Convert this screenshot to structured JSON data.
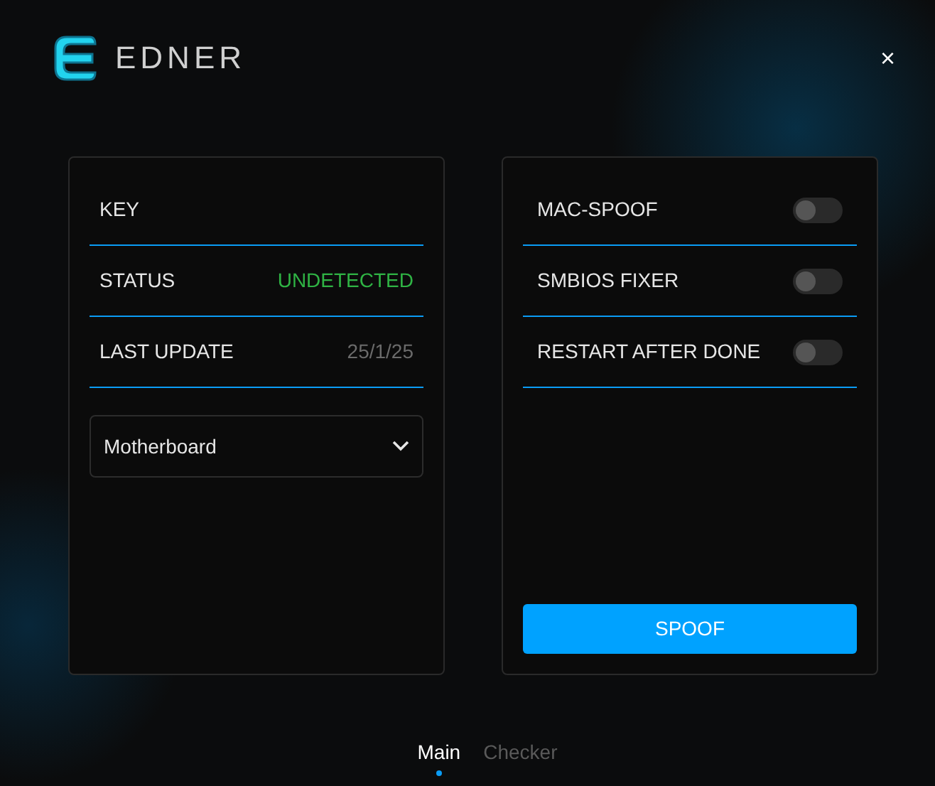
{
  "header": {
    "brand": "EDNER",
    "close": "×"
  },
  "info_panel": {
    "rows": [
      {
        "kind": "label",
        "label": "KEY"
      },
      {
        "kind": "value",
        "label": "STATUS",
        "value": "UNDETECTED",
        "color": "#2fb344"
      },
      {
        "kind": "value",
        "label": "LAST UPDATE",
        "value": "25/1/25",
        "color": "#6b6b6b"
      }
    ],
    "dropdown": {
      "value": "Motherboard"
    }
  },
  "options_panel": {
    "toggles": [
      {
        "label": "MAC-SPOOF",
        "on": false
      },
      {
        "label": "SMBIOS FIXER",
        "on": false
      },
      {
        "label": "RESTART AFTER DONE",
        "on": false
      }
    ],
    "button": "SPOOF"
  },
  "tabs": [
    {
      "label": "Main",
      "selected": true
    },
    {
      "label": "Checker",
      "selected": false
    }
  ]
}
